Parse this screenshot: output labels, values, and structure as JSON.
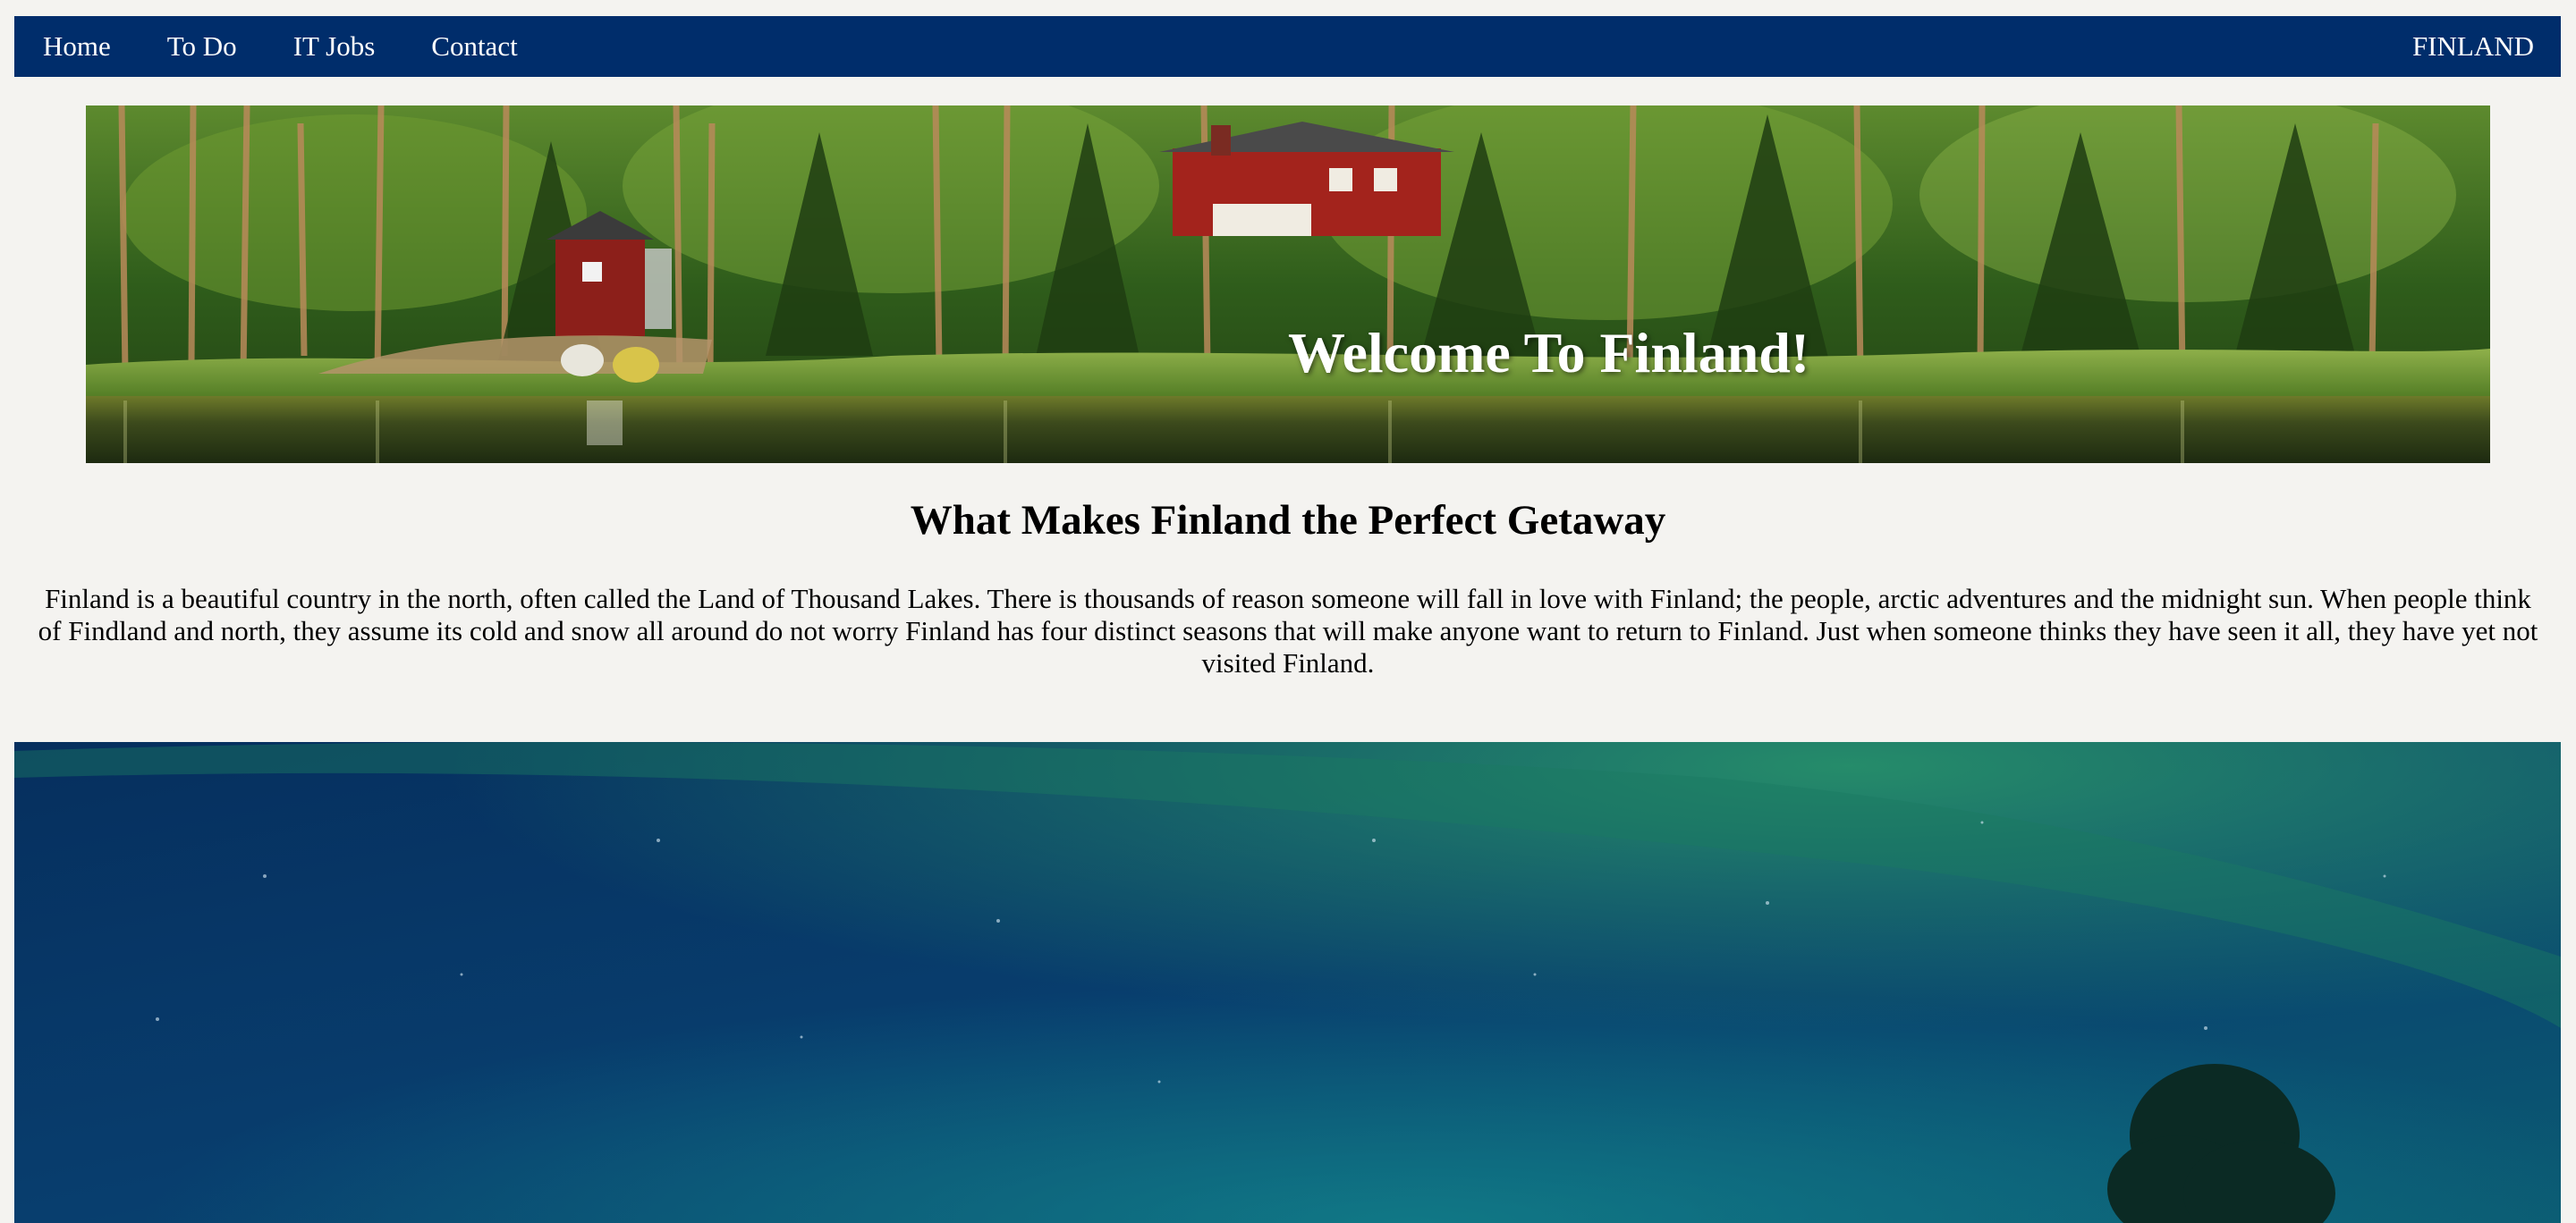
{
  "nav": {
    "links": [
      "Home",
      "To Do",
      "IT Jobs",
      "Contact"
    ],
    "brand": "FINLAND"
  },
  "hero": {
    "title": "Welcome To Finland!"
  },
  "main": {
    "heading": "What Makes Finland the Perfect Getaway",
    "intro": "Finland is a beautiful country in the north, often called the Land of Thousand Lakes. There is thousands of reason someone will fall in love with Finland; the people, arctic adventures and the midnight sun. When people think of Findland and north, they assume its cold and snow all around do not worry Finland has four distinct seasons that will make anyone want to return to Finland. Just when someone thinks they have seen it all, they have yet not visited Finland."
  },
  "colors": {
    "nav_bg": "#002d6b",
    "page_bg": "#f4f3f0",
    "aurora_sky": "#073a6b",
    "aurora_green": "#1f8a5f"
  },
  "icons": {
    "hero_image": "lake-cabin-forest-photo",
    "aurora_image": "northern-lights-photo"
  }
}
